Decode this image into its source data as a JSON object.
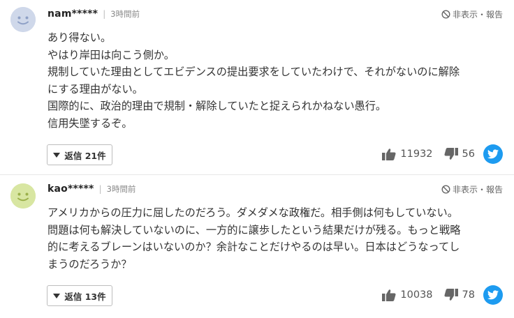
{
  "comments": [
    {
      "username": "nam*****",
      "time": "3時間前",
      "report_label": "非表示・報告",
      "lines": [
        "あり得ない。",
        "やはり岸田は向こう側か。",
        "規制していた理由としてエビデンスの提出要求をしていたわけで、それがないのに解除",
        "にする理由がない。",
        "国際的に、政治的理由で規制・解除していたと捉えられかねない愚行。",
        "信用失墜するぞ。"
      ],
      "reply_label": "返信 21件",
      "likes": "11932",
      "dislikes": "56",
      "avatar_color": "#cfd8ea"
    },
    {
      "username": "kao*****",
      "time": "3時間前",
      "report_label": "非表示・報告",
      "lines": [
        "アメリカからの圧力に屈したのだろう。ダメダメな政権だ。相手側は何もしていない。",
        "問題は何も解決していないのに、一方的に譲歩したという結果だけが残る。もっと戦略",
        "的に考えるブレーンはいないのか？余計なことだけやるのは早い。日本はどうなってし",
        "まうのだろうか？"
      ],
      "reply_label": "返信 13件",
      "likes": "10038",
      "dislikes": "78",
      "avatar_color": "#d8e6a2"
    }
  ],
  "colors": {
    "twitter": "#1d9bf0"
  }
}
